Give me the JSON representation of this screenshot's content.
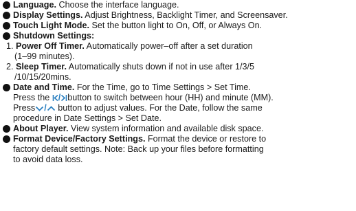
{
  "accent_color": "#2a7fc0",
  "items": [
    {
      "title": "Language.",
      "text": " Choose the interface language."
    },
    {
      "title": "Display Settings.",
      "text": " Adjust Brightness, Backlight Timer, and Screensaver."
    },
    {
      "title": "Touch Light Mode.",
      "text": " Set the button light to On, Off, or Always On."
    },
    {
      "title": "Shutdown Settings:"
    }
  ],
  "shutdown": {
    "power_off": {
      "num": "1. ",
      "title": "Power Off Timer.",
      "line1": " Automatically power–off after a set duration",
      "line2": "(1–99 minutes)."
    },
    "sleep": {
      "num": "2. ",
      "title": "Sleep Timer.",
      "line1": " Automatically shuts down if not in use after 1/3/5",
      "line2": "/10/15/20mins."
    }
  },
  "date_time": {
    "title": "Date and Time.",
    "line1": " For the Time, go to Time Settings > Set Time.",
    "line2a": "Press the ",
    "line2b": "button to switch between hour (HH) and minute (MM).",
    "line3a": "Press",
    "line3b": " button to adjust values. For the Date, follow the same",
    "line4": "procedure in Date Settings > Set Date.",
    "icons": [
      "prev-icon",
      "next-icon",
      "down-chevron-icon",
      "up-chevron-icon"
    ]
  },
  "about": {
    "title": "About Player.",
    "text": " View system information and available disk space."
  },
  "format": {
    "title": "Format Device/Factory Settings.",
    "line1": " Format the device or restore to",
    "line2": "factory default settings. Note: Back up your files before formatting",
    "line3": "to avoid data loss."
  }
}
